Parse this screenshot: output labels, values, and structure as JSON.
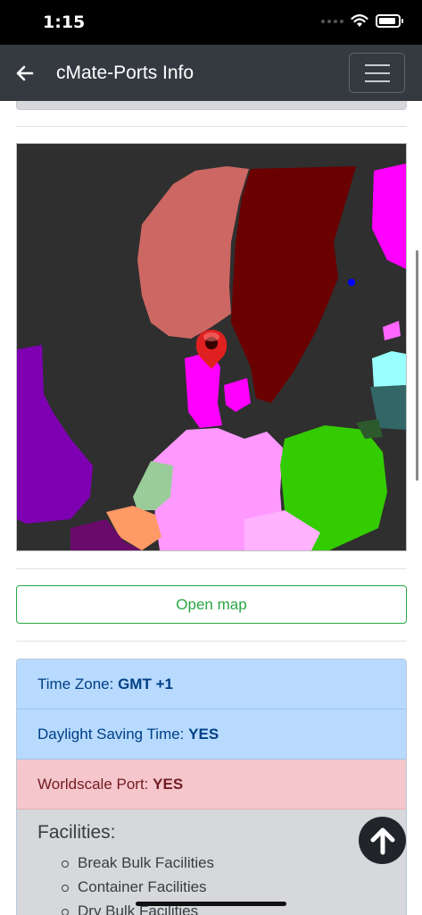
{
  "status_bar": {
    "time": "1:15",
    "icons": [
      "signal-icon",
      "wifi-icon",
      "battery-icon"
    ]
  },
  "navbar": {
    "title": "cMate-Ports Info",
    "back_icon": "arrow-left-icon",
    "menu_icon": "hamburger-menu-icon"
  },
  "map": {
    "marker_icon": "map-pin-icon",
    "colors": {
      "sea": "#2f2f2f",
      "norway": "#cd6763",
      "sweden": "#6b0000",
      "denmark": "#ff00ff",
      "germany": "#ff99ff",
      "poland": "#33cc00",
      "uk": "#7f00b2",
      "netherlands": "#99cc99",
      "belgium": "#ff9966",
      "baltic_pink": "#ff00ff",
      "lithuania": "#336666",
      "latvia": "#99ffff"
    }
  },
  "open_map": {
    "label": "Open map",
    "color": "#28a745"
  },
  "info": {
    "time_zone_label": "Time Zone:",
    "time_zone_value": "GMT +1",
    "dst_label": "Daylight Saving Time:",
    "dst_value": "YES",
    "worldscale_label": "Worldscale Port:",
    "worldscale_value": "YES"
  },
  "facilities": {
    "title": "Facilities:",
    "items": [
      "Break Bulk Facilities",
      "Container Facilities",
      "Dry Bulk Facilities"
    ]
  },
  "scroll_top": {
    "icon": "arrow-up-circle-icon"
  }
}
